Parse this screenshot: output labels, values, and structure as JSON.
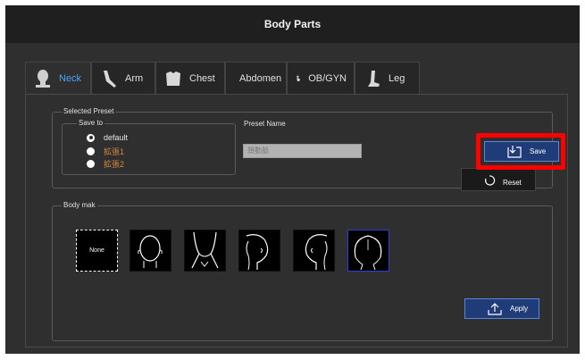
{
  "window": {
    "title": "Body Parts"
  },
  "tabs": [
    {
      "label": "Neck",
      "icon": "neck-icon",
      "active": true
    },
    {
      "label": "Arm",
      "icon": "arm-icon",
      "active": false
    },
    {
      "label": "Chest",
      "icon": "chest-icon",
      "active": false
    },
    {
      "label": "Abdomen",
      "icon": "abdomen-icon",
      "active": false
    },
    {
      "label": "OB/GYN",
      "icon": "obgyn-icon",
      "active": false
    },
    {
      "label": "Leg",
      "icon": "leg-icon",
      "active": false
    }
  ],
  "selected_preset": {
    "legend": "Selected Preset",
    "save_to": {
      "legend": "Save to",
      "options": [
        {
          "label": "default",
          "checked": true
        },
        {
          "label": "拡張1",
          "checked": false
        },
        {
          "label": "拡張2",
          "checked": false
        }
      ]
    },
    "preset_name_label": "Preset Name",
    "preset_name_placeholder": "頚動脈"
  },
  "buttons": {
    "save": "Save",
    "reset": "Reset",
    "apply": "Apply"
  },
  "body_mark": {
    "legend": "Body mak",
    "none_label": "None",
    "thumbnails": [
      "none",
      "head-front-icon",
      "neck-front-icon",
      "head-right-profile-icon",
      "head-left-profile-icon",
      "head-back-icon"
    ],
    "selected_index": 5
  },
  "colors": {
    "accent": "#4aa3ff",
    "highlight": "#ff0000",
    "button_bg": "#1f3c78",
    "orange_text": "#d98840"
  }
}
